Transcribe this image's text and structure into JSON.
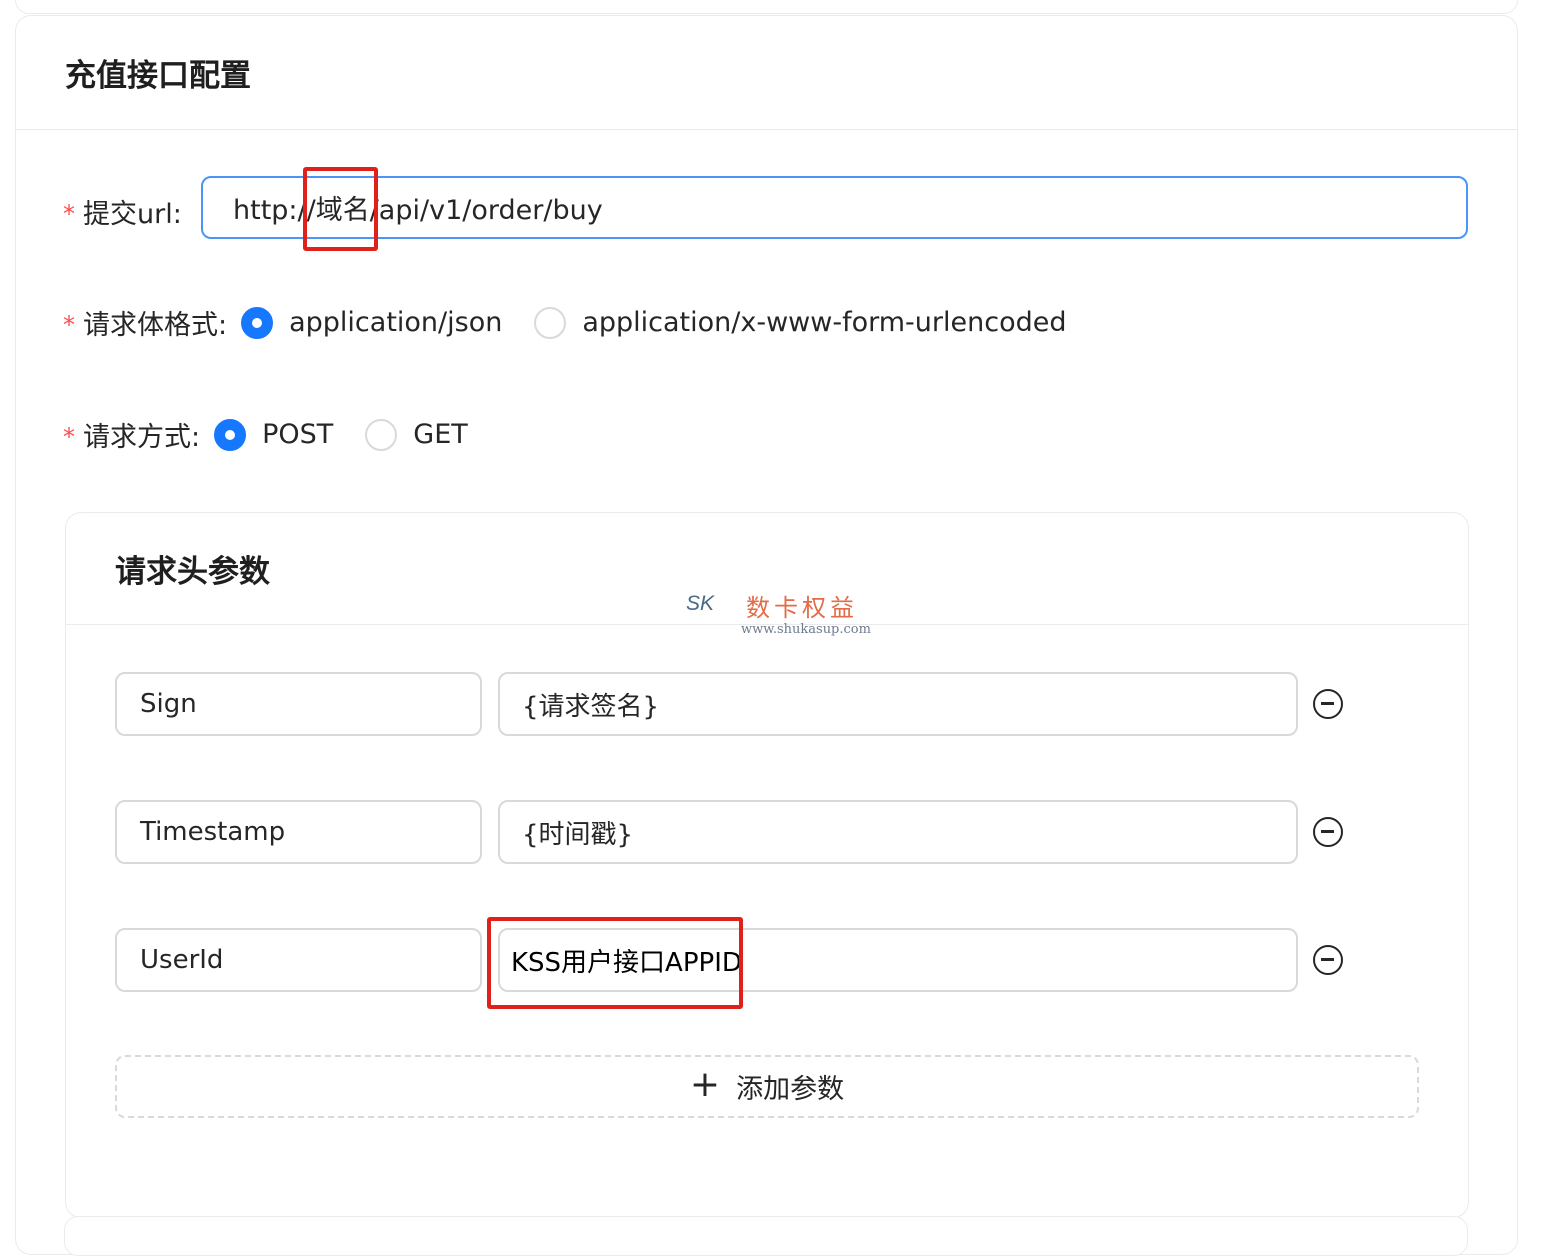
{
  "card": {
    "title": "充值接口配置"
  },
  "form": {
    "required_mark": "*",
    "url": {
      "label": "提交url:",
      "value": "http://域名/api/v1/order/buy"
    },
    "body_format": {
      "label": "请求体格式:",
      "options": [
        "application/json",
        "application/x-www-form-urlencoded"
      ],
      "selected": "application/json"
    },
    "method": {
      "label": "请求方式:",
      "options": [
        "POST",
        "GET"
      ],
      "selected": "POST"
    }
  },
  "headers": {
    "title": "请求头参数",
    "params": [
      {
        "key": "Sign",
        "value": "{请求签名}"
      },
      {
        "key": "Timestamp",
        "value": "{时间戳}"
      },
      {
        "key": "UserId",
        "value": "KSS用户接口APPID"
      }
    ],
    "add_button": {
      "icon": "plus-icon",
      "label": "添加参数"
    }
  },
  "watermark": {
    "logo": "SK",
    "title": "数卡权益",
    "url": "www.shukasup.com"
  },
  "colors": {
    "primary": "#1677ff",
    "required": "#ff4d4f",
    "annotation": "#e0201b",
    "focus_border": "#4a95f5"
  }
}
